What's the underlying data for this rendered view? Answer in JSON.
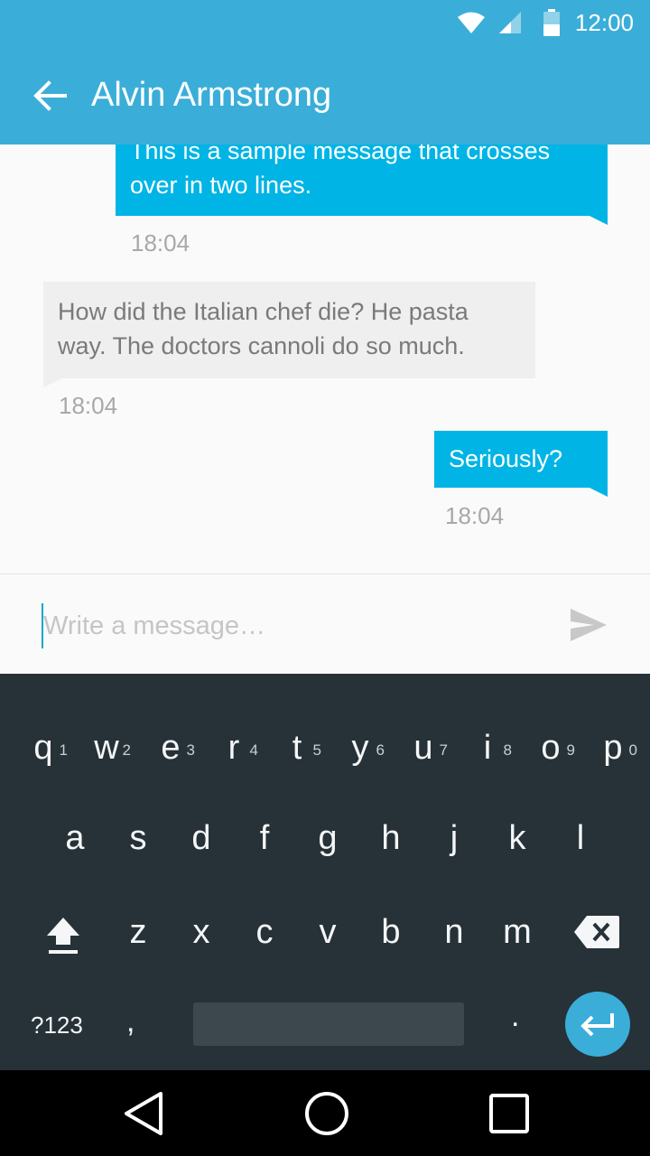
{
  "status_bar": {
    "time": "12:00"
  },
  "toolbar": {
    "title": "Alvin Armstrong"
  },
  "messages": [
    {
      "direction": "out",
      "text": "This is a sample message that crosses over in two lines.",
      "line1": "This is a sample message that crosses",
      "line2": "over in two lines.",
      "time": "18:04"
    },
    {
      "direction": "in",
      "line1": "How did the Italian chef die? He pasta",
      "line2": "way. The doctors cannoli do so much.",
      "time": "18:04"
    },
    {
      "direction": "out",
      "text": "Seriously?",
      "time": "18:04"
    }
  ],
  "composer": {
    "placeholder": "Write a message…",
    "value": ""
  },
  "keyboard": {
    "row1": [
      "q",
      "w",
      "e",
      "r",
      "t",
      "y",
      "u",
      "i",
      "o",
      "p"
    ],
    "row1_hints": [
      "1",
      "2",
      "3",
      "4",
      "5",
      "6",
      "7",
      "8",
      "9",
      "0"
    ],
    "row2": [
      "a",
      "s",
      "d",
      "f",
      "g",
      "h",
      "j",
      "k",
      "l"
    ],
    "row3": [
      "z",
      "x",
      "c",
      "v",
      "b",
      "n",
      "m"
    ],
    "symbols_label": "?123",
    "comma": ",",
    "period": "."
  },
  "colors": {
    "primary": "#3aaed8",
    "outgoing_bubble": "#00b4e5",
    "incoming_bubble": "#efefef",
    "keyboard_bg": "#263238"
  },
  "icons": [
    "wifi-icon",
    "signal-icon",
    "battery-icon",
    "back-arrow-icon",
    "send-icon",
    "shift-icon",
    "backspace-icon",
    "enter-icon",
    "nav-back-icon",
    "nav-home-icon",
    "nav-recents-icon"
  ]
}
